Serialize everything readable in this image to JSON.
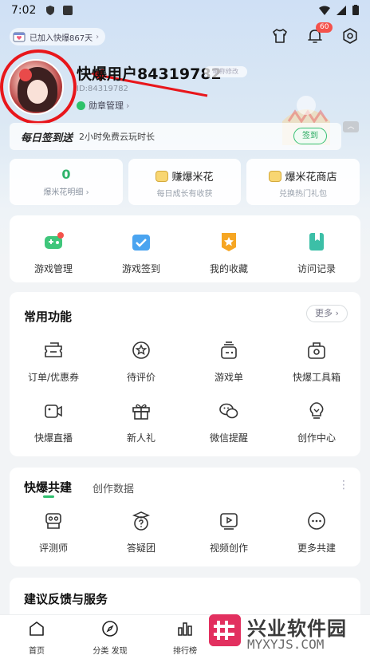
{
  "status_bar": {
    "time": "7:02"
  },
  "header": {
    "joined_text": "已加入快爆867天",
    "notification_count": "60",
    "username": "快爆用户84319782",
    "name_tag": "昵称修改",
    "user_id": "ID:84319782",
    "medal_label": "勋章管理",
    "medal_chevron": "›"
  },
  "daily": {
    "title": "每日签到送",
    "desc": "2小时免费云玩时长",
    "button": "签到"
  },
  "stats": [
    {
      "value": "0",
      "label": "爆米花明细 ›"
    },
    {
      "title": "赚爆米花",
      "sub": "每日成长有收获"
    },
    {
      "title": "爆米花商店",
      "sub": "兑换热门礼包"
    }
  ],
  "quick": [
    {
      "label": "游戏管理",
      "icon": "game-controller-icon"
    },
    {
      "label": "游戏签到",
      "icon": "calendar-check-icon"
    },
    {
      "label": "我的收藏",
      "icon": "star-badge-icon"
    },
    {
      "label": "访问记录",
      "icon": "bookmark-icon"
    }
  ],
  "common": {
    "title": "常用功能",
    "more": "更多 ›",
    "row1": [
      {
        "label": "订单/优惠券",
        "icon": "coupon-icon"
      },
      {
        "label": "待评价",
        "icon": "star-circle-icon"
      },
      {
        "label": "游戏单",
        "icon": "game-list-icon"
      },
      {
        "label": "快爆工具箱",
        "icon": "toolbox-icon"
      }
    ],
    "row2": [
      {
        "label": "快爆直播",
        "icon": "live-camera-icon"
      },
      {
        "label": "新人礼",
        "icon": "gift-icon"
      },
      {
        "label": "微信提醒",
        "icon": "wechat-icon"
      },
      {
        "label": "创作中心",
        "icon": "lightbulb-icon"
      }
    ]
  },
  "co_build": {
    "tab_active": "快爆共建",
    "tab_inactive": "创作数据",
    "items": [
      {
        "label": "评测师",
        "icon": "reviewer-icon"
      },
      {
        "label": "答疑团",
        "icon": "qa-icon"
      },
      {
        "label": "视频创作",
        "icon": "video-play-icon"
      },
      {
        "label": "更多共建",
        "icon": "more-dots-icon"
      }
    ]
  },
  "feedback": {
    "title": "建议反馈与服务"
  },
  "bottom_nav": [
    {
      "label": "首页",
      "icon": "home-icon"
    },
    {
      "label": "分类 发现",
      "icon": "compass-icon"
    },
    {
      "label": "排行榜",
      "icon": "bar-chart-icon"
    }
  ],
  "watermark": {
    "title": "兴业软件园",
    "url": "MYXYJS.COM"
  },
  "colors": {
    "accent_green": "#2fb36a",
    "badge_red": "#f4524b",
    "annotation_red": "#e8161b"
  }
}
